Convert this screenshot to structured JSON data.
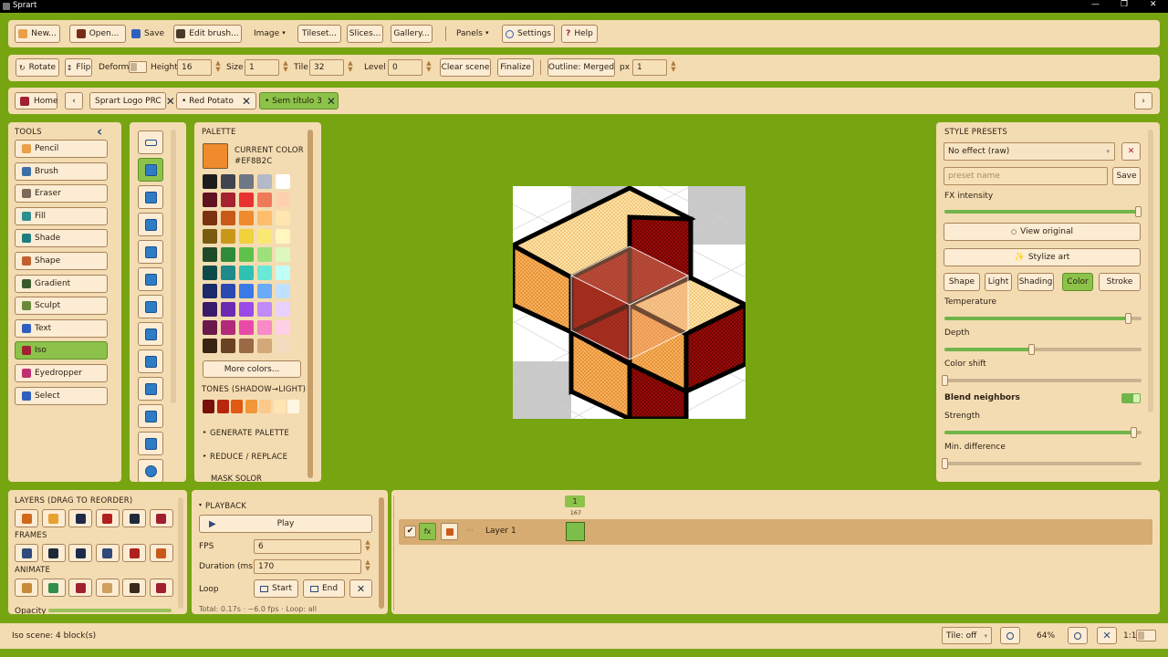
{
  "app": {
    "title": "Sprart"
  },
  "window_controls": {
    "minimize": "—",
    "restore": "❐",
    "close": "✕"
  },
  "menubar": {
    "new": "New...",
    "open": "Open...",
    "save": "Save",
    "edit_brush": "Edit brush...",
    "image": "Image",
    "tileset": "Tileset...",
    "slices": "Slices...",
    "gallery": "Gallery...",
    "panels": "Panels",
    "settings": "Settings",
    "help": "Help",
    "dropdown_arrow": "▾"
  },
  "toolbar": {
    "rotate": "Rotate",
    "flip": "Flip",
    "deform": "Deform",
    "height_label": "Height",
    "height_value": "16",
    "size_label": "Size",
    "size_value": "1",
    "tile_label": "Tile",
    "tile_value": "32",
    "level_label": "Level",
    "level_value": "0",
    "clear_scene": "Clear scene",
    "finalize": "Finalize",
    "outline": "Outline: Merged",
    "px_label": "px",
    "px_value": "1"
  },
  "tabs": {
    "home": "Home",
    "prev": "‹",
    "next": "›",
    "items": [
      {
        "label": "Sprart Logo PRC"
      },
      {
        "label": "• Red Potato"
      },
      {
        "label": "• Sem título 3"
      }
    ]
  },
  "tools_panel": {
    "title": "TOOLS",
    "collapse": "‹",
    "items": [
      "Pencil",
      "Brush",
      "Eraser",
      "Fill",
      "Shade",
      "Shape",
      "Gradient",
      "Sculpt",
      "Text",
      "Iso",
      "Eyedropper",
      "Select"
    ],
    "colors": [
      "#e8a04a",
      "#3b6fa8",
      "#7d6a5a",
      "#2f8f8f",
      "#1f7d7d",
      "#c06030",
      "#3a5a2a",
      "#6a8a3a",
      "#2f5fbf",
      "#a02030",
      "#c03070",
      "#2f5fbf"
    ]
  },
  "palette": {
    "title": "PALETTE",
    "current_color_label": "CURRENT COLOR",
    "current_color_hex": "#EF8B2C",
    "current_color": "#ef8b2c",
    "rows": [
      [
        "#1c1c1c",
        "#3f4550",
        "#6f7686",
        "#b3b9c6",
        "#ffffff"
      ],
      [
        "#5e1320",
        "#a52230",
        "#e83232",
        "#ef7a5a",
        "#ffcfb2"
      ],
      [
        "#7b3211",
        "#c75a16",
        "#ef8b2c",
        "#ffbd6b",
        "#ffe6b0"
      ],
      [
        "#7a5a10",
        "#c9971a",
        "#efd23c",
        "#fbe872",
        "#fff6c0"
      ],
      [
        "#1e4a2a",
        "#2f8a3a",
        "#5ec24a",
        "#9ee07a",
        "#dcf8c0"
      ],
      [
        "#0f4a4a",
        "#1f8a8a",
        "#2fc2b2",
        "#6ae8d8",
        "#c0fff8"
      ],
      [
        "#1a2a6a",
        "#2a4ab2",
        "#3a7ae8",
        "#6aaaf8",
        "#c0e0ff"
      ],
      [
        "#3a1a6a",
        "#6a2ab2",
        "#9a4ae8",
        "#c08af8",
        "#e8d0ff"
      ],
      [
        "#6a1a4a",
        "#b22a7a",
        "#e84aa8",
        "#f88ac8",
        "#ffd0e8"
      ],
      [
        "#3a2414",
        "#6a4224",
        "#9a6a44",
        "#d4a878",
        "#f2dcc0"
      ]
    ],
    "more_colors": "More colors...",
    "tones_label": "TONES (SHADOW→LIGHT)",
    "tones": [
      "#7a0f0a",
      "#b8260e",
      "#df5a12",
      "#f2963a",
      "#fbc98a",
      "#ffe4b4",
      "#fff6e2"
    ],
    "generate_palette": "GENERATE PALETTE",
    "reduce_replace": "REDUCE / REPLACE",
    "cut_off": "MASK SOLOR"
  },
  "style_presets": {
    "title": "STYLE PRESETS",
    "preset_value": "No effect (raw)",
    "clear": "✕",
    "name_placeholder": "preset name",
    "save": "Save",
    "fx_intensity": "FX intensity",
    "fx_intensity_value": 0.99,
    "view_original": "View original",
    "stylize_art": "Stylize art",
    "tabs": [
      "Shape",
      "Light",
      "Shading",
      "Color",
      "Stroke"
    ],
    "active_tab": "Color",
    "temperature": "Temperature",
    "temperature_value": 0.93,
    "depth": "Depth",
    "depth_value": 0.44,
    "color_shift": "Color shift",
    "color_shift_value": 0.0,
    "blend_neighbors": "Blend neighbors",
    "strength": "Strength",
    "strength_value": 0.96,
    "min_difference": "Min. difference",
    "min_difference_value": 0.0
  },
  "layers": {
    "title": "LAYERS (DRAG TO REORDER)",
    "frames": "FRAMES",
    "animate": "ANIMATE",
    "opacity": "Opacity"
  },
  "playback": {
    "title": "PLAYBACK",
    "play": "Play",
    "fps_label": "FPS",
    "fps_value": "6",
    "duration_label": "Duration (ms)",
    "duration_value": "170",
    "loop_label": "Loop",
    "start": "Start",
    "end": "End",
    "summary": "Total: 0.17s · ~6.0 fps · Loop: all"
  },
  "timeline": {
    "frame_number": "1",
    "frame_duration": "167",
    "fx": "fx",
    "dots": "···",
    "layer_name": "Layer 1"
  },
  "statusbar": {
    "status": "Iso scene: 4 block(s)",
    "tile": "Tile: off",
    "zoom": "64%",
    "ratio": "1:1"
  }
}
